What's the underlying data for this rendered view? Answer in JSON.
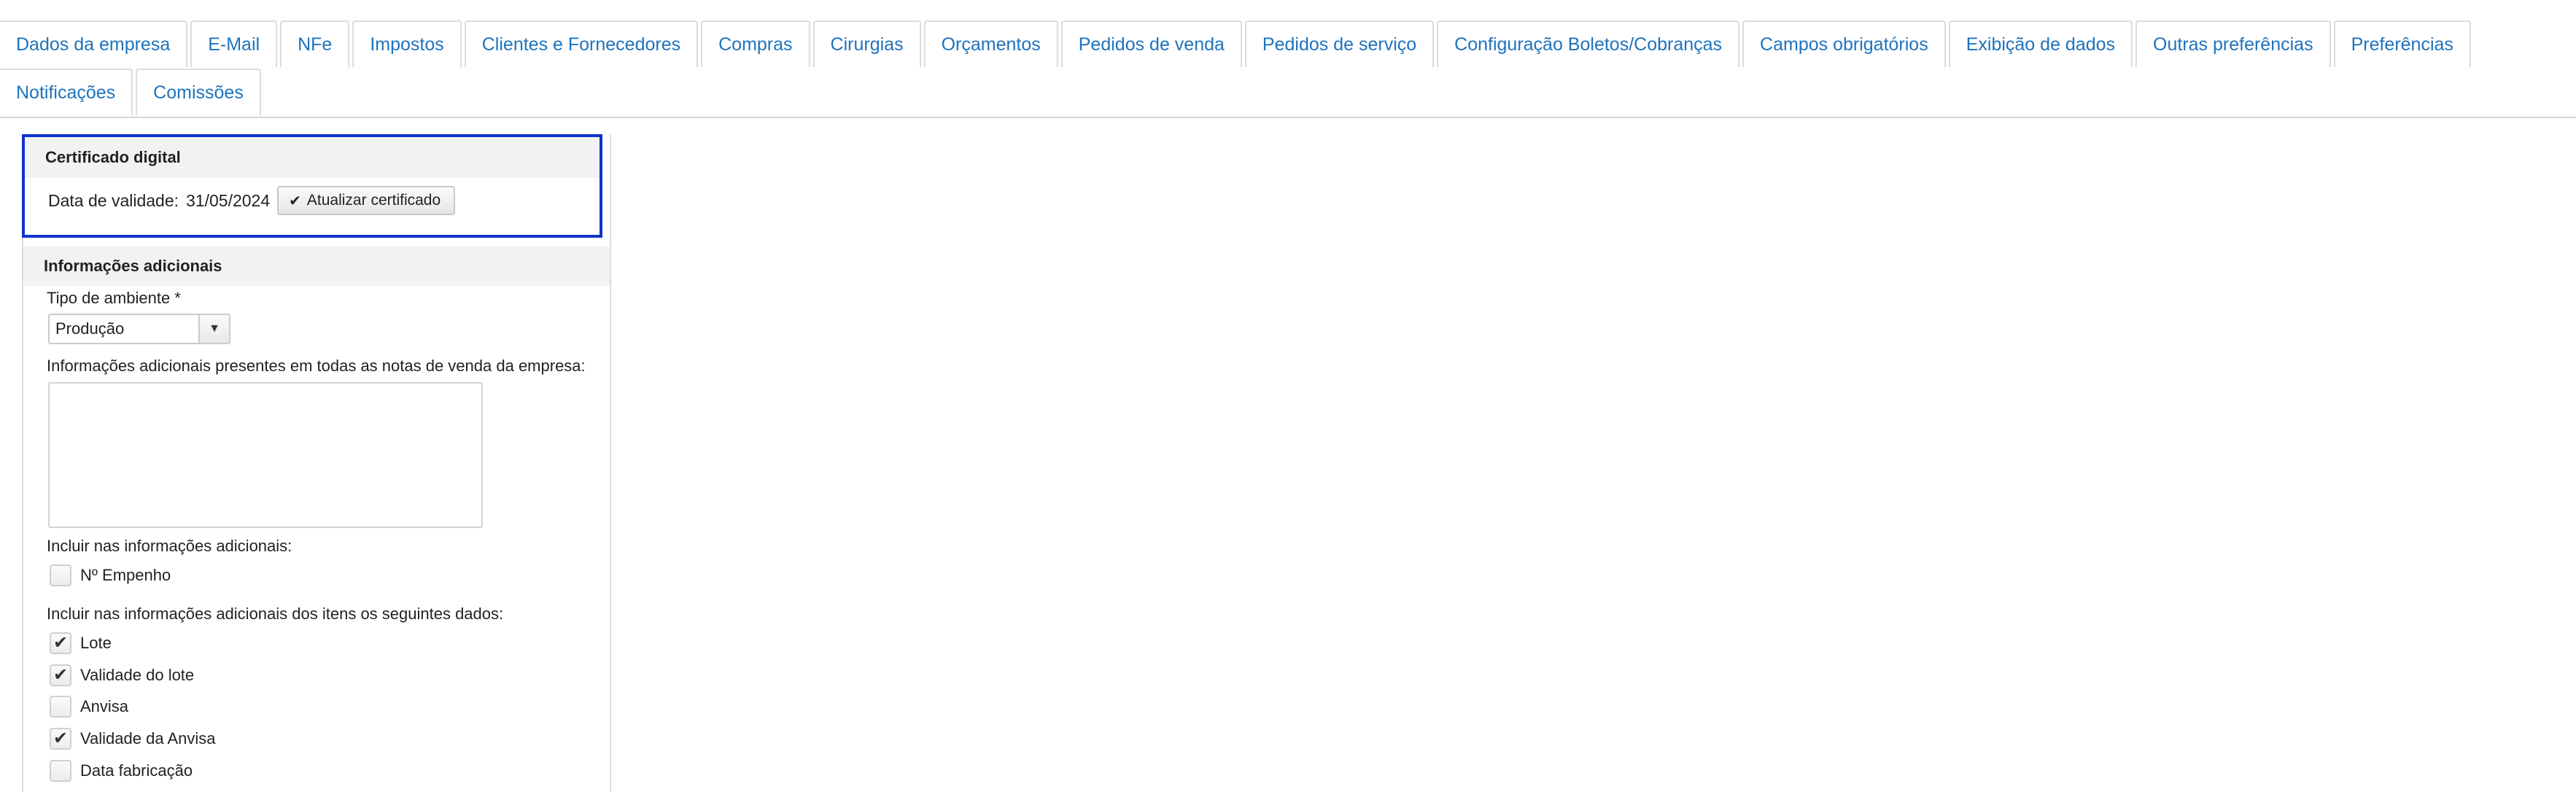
{
  "tabs_row1": [
    {
      "label": "Dados da empresa"
    },
    {
      "label": "E-Mail"
    },
    {
      "label": "NFe"
    },
    {
      "label": "Impostos"
    },
    {
      "label": "Clientes e Fornecedores"
    },
    {
      "label": "Compras"
    },
    {
      "label": "Cirurgias"
    },
    {
      "label": "Orçamentos"
    },
    {
      "label": "Pedidos de venda"
    },
    {
      "label": "Pedidos de serviço"
    },
    {
      "label": "Configuração Boletos/Cobranças"
    },
    {
      "label": "Campos obrigatórios"
    },
    {
      "label": "Exibição de dados"
    },
    {
      "label": "Outras preferências"
    },
    {
      "label": "Preferências"
    }
  ],
  "tabs_row2": [
    {
      "label": "Notificações"
    },
    {
      "label": "Comissões"
    }
  ],
  "certificate": {
    "title": "Certificado digital",
    "validity_label": "Data de validade:",
    "validity_value": "31/05/2024",
    "update_button": "Atualizar certificado",
    "update_icon": "✔"
  },
  "additional_info": {
    "title": "Informações adicionais",
    "env_label": "Tipo de ambiente *",
    "env_value": "Produção",
    "notes_label": "Informações adicionais presentes em todas as notas de venda da empresa:",
    "notes_value": "",
    "include_label": "Incluir nas informações adicionais:",
    "include_options": [
      {
        "label": "Nº Empenho",
        "checked": false
      }
    ],
    "items_label": "Incluir nas informações adicionais dos itens os seguintes dados:",
    "items_options": [
      {
        "label": "Lote",
        "checked": true
      },
      {
        "label": "Validade do lote",
        "checked": true
      },
      {
        "label": "Anvisa",
        "checked": false
      },
      {
        "label": "Validade da Anvisa",
        "checked": true
      },
      {
        "label": "Data fabricação",
        "checked": false
      }
    ]
  },
  "colors": {
    "tab_text": "#1e73be",
    "highlight_border": "#1133cc"
  },
  "icons": {
    "dropdown": "caret-down-icon",
    "check": "check-icon"
  }
}
